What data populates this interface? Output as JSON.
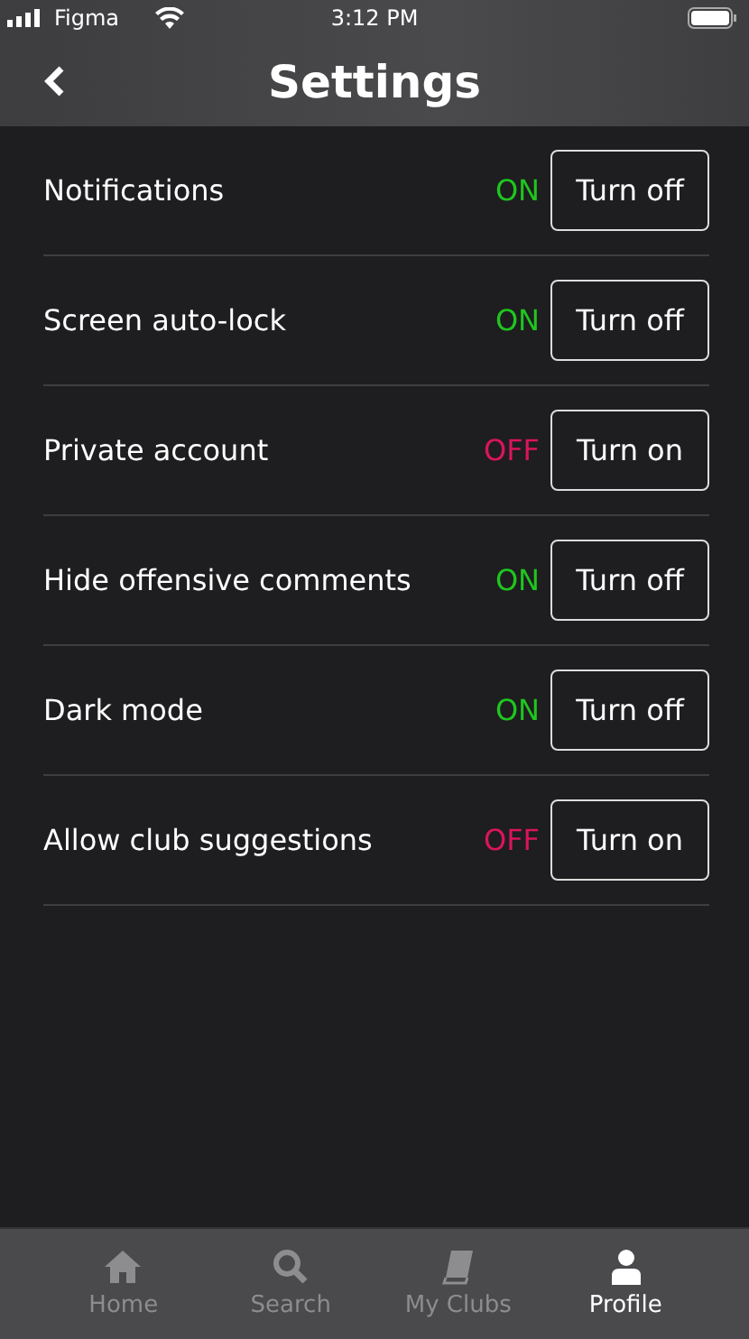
{
  "status_bar": {
    "carrier": "Figma",
    "time": "3:12 PM"
  },
  "header": {
    "title": "Settings"
  },
  "settings": [
    {
      "label": "Notifications",
      "on": true,
      "status": "ON",
      "action": "Turn off"
    },
    {
      "label": "Screen auto-lock",
      "on": true,
      "status": "ON",
      "action": "Turn off"
    },
    {
      "label": "Private account",
      "on": false,
      "status": "OFF",
      "action": "Turn on"
    },
    {
      "label": "Hide offensive comments",
      "on": true,
      "status": "ON",
      "action": "Turn off"
    },
    {
      "label": "Dark mode",
      "on": true,
      "status": "ON",
      "action": "Turn off"
    },
    {
      "label": "Allow club suggestions",
      "on": false,
      "status": "OFF",
      "action": "Turn on"
    }
  ],
  "tabs": [
    {
      "kind": "home",
      "label": "Home",
      "selected": false
    },
    {
      "kind": "search",
      "label": "Search",
      "selected": false
    },
    {
      "kind": "book",
      "label": "My Clubs",
      "selected": false
    },
    {
      "kind": "person",
      "label": "Profile",
      "selected": true
    }
  ]
}
